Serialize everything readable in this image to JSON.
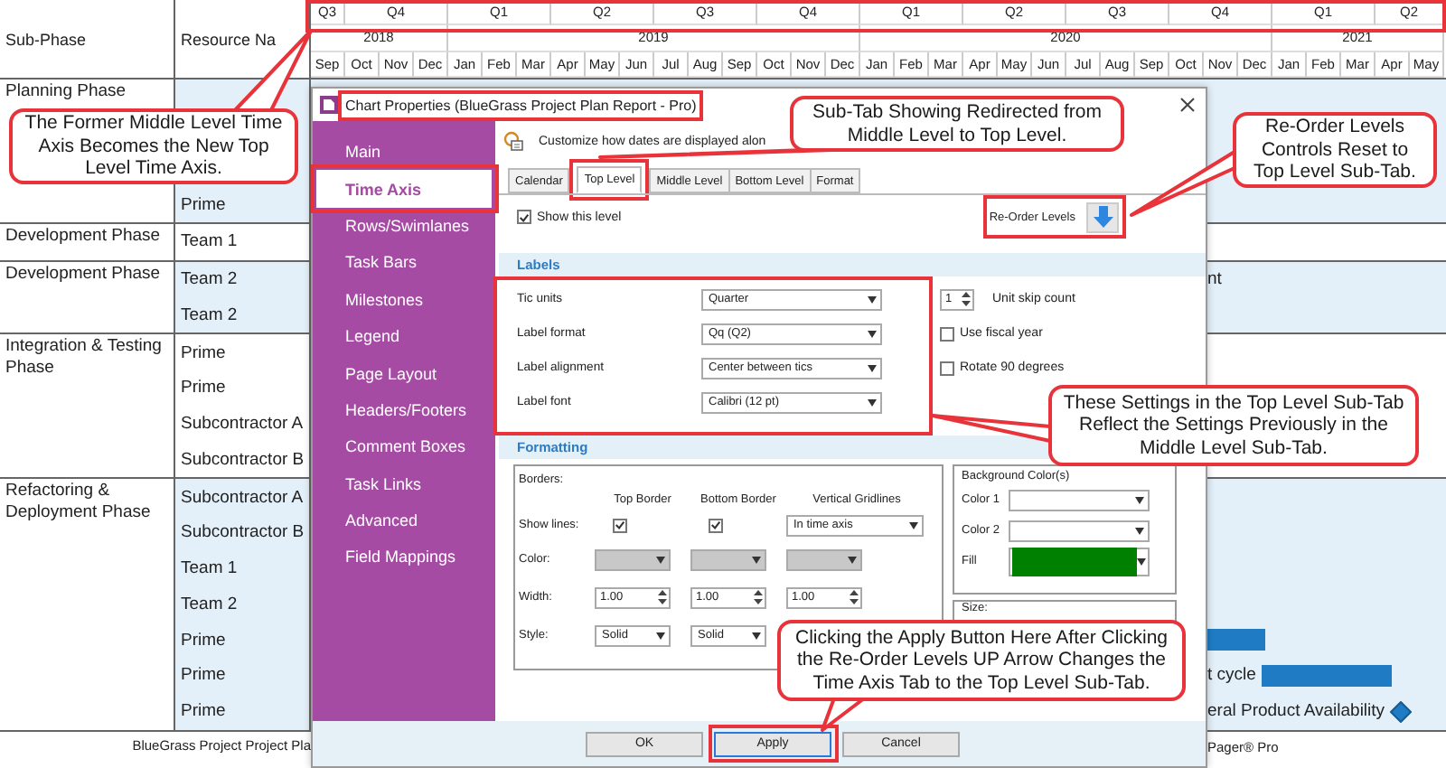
{
  "gantt": {
    "columns": [
      "Sub-Phase",
      "Resource Na"
    ],
    "years": [
      {
        "label": "2018",
        "quarters": [
          {
            "label": "Q3",
            "months": [
              "Sep"
            ]
          },
          {
            "label": "Q4",
            "months": [
              "Oct",
              "Nov",
              "Dec"
            ]
          }
        ]
      },
      {
        "label": "2019",
        "quarters": [
          {
            "label": "Q1",
            "months": [
              "Jan",
              "Feb",
              "Mar"
            ]
          },
          {
            "label": "Q2",
            "months": [
              "Apr",
              "May",
              "Jun"
            ]
          },
          {
            "label": "Q3",
            "months": [
              "Jul",
              "Aug",
              "Sep"
            ]
          },
          {
            "label": "Q4",
            "months": [
              "Oct",
              "Nov",
              "Dec"
            ]
          }
        ]
      },
      {
        "label": "2020",
        "quarters": [
          {
            "label": "Q1",
            "months": [
              "Jan",
              "Feb",
              "Mar"
            ]
          },
          {
            "label": "Q2",
            "months": [
              "Apr",
              "May",
              "Jun"
            ]
          },
          {
            "label": "Q3",
            "months": [
              "Jul",
              "Aug",
              "Sep"
            ]
          },
          {
            "label": "Q4",
            "months": [
              "Oct",
              "Nov",
              "Dec"
            ]
          }
        ]
      },
      {
        "label": "2021",
        "quarters": [
          {
            "label": "Q1",
            "months": [
              "Jan",
              "Feb",
              "Mar"
            ]
          },
          {
            "label": "Q2",
            "months": [
              "Apr",
              "May"
            ]
          }
        ]
      }
    ],
    "groups": [
      {
        "sub_phase": "Planning Phase",
        "rows": [
          {},
          {},
          {},
          {
            "resource": "Prime"
          }
        ]
      },
      {
        "sub_phase": "Development Phase",
        "rows": [
          {
            "resource": "Team 1"
          }
        ]
      },
      {
        "sub_phase": "Development Phase",
        "rows": [
          {
            "resource": "Team 2",
            "items": [
              {
                "kind": "label",
                "text": "nt"
              }
            ]
          },
          {
            "resource": "Team 2"
          }
        ]
      },
      {
        "sub_phase": "Integration & Testing Phase",
        "rows": [
          {
            "resource": "Prime"
          },
          {
            "resource": "Prime"
          },
          {
            "resource": "Subcontractor A"
          },
          {
            "resource": "Subcontractor B"
          }
        ]
      },
      {
        "sub_phase": "Refactoring & Deployment Phase",
        "rows": [
          {
            "resource": "Subcontractor A"
          },
          {
            "resource": "Subcontractor B"
          },
          {
            "resource": "Team 1"
          },
          {
            "resource": "Team 2"
          },
          {
            "resource": "Prime",
            "items": [
              {
                "kind": "bar"
              }
            ]
          },
          {
            "resource": "Prime",
            "items": [
              {
                "kind": "label",
                "text": "t cycle"
              },
              {
                "kind": "bar"
              }
            ]
          },
          {
            "resource": "Prime",
            "items": [
              {
                "kind": "label",
                "text": "eral Product Availability"
              },
              {
                "kind": "milestone"
              }
            ]
          }
        ]
      }
    ],
    "footer": [
      "BlueGrass Project Project Pla",
      "Pager® Pro"
    ]
  },
  "dialog": {
    "title": "Chart Properties (BlueGrass Project Plan Report - Pro)",
    "nav": [
      {
        "label": "Main",
        "selected": false
      },
      {
        "label": "Time Axis",
        "selected": true
      },
      {
        "label": "Rows/Swimlanes",
        "selected": false
      },
      {
        "label": "Task Bars",
        "selected": false
      },
      {
        "label": "Milestones",
        "selected": false
      },
      {
        "label": "Legend",
        "selected": false
      },
      {
        "label": "Page Layout",
        "selected": false
      },
      {
        "label": "Headers/Footers",
        "selected": false
      },
      {
        "label": "Comment Boxes",
        "selected": false
      },
      {
        "label": "Task Links",
        "selected": false
      },
      {
        "label": "Advanced",
        "selected": false
      },
      {
        "label": "Field Mappings",
        "selected": false
      }
    ],
    "description": "Customize how dates are displayed alon",
    "tabs": [
      {
        "label": "Calendar",
        "selected": false
      },
      {
        "label": "Top Level",
        "selected": true
      },
      {
        "label": "Middle Level",
        "selected": false
      },
      {
        "label": "Bottom Level",
        "selected": false
      },
      {
        "label": "Format",
        "selected": false
      }
    ],
    "show_level": {
      "label": "Show this level",
      "checked": true
    },
    "reorder_label": "Re-Order Levels",
    "labels": {
      "title": "Labels",
      "fields": [
        {
          "label": "Tic units",
          "value": "Quarter"
        },
        {
          "label": "Label format",
          "value": "Qq (Q2)"
        },
        {
          "label": "Label alignment",
          "value": "Center between tics"
        },
        {
          "label": "Label font",
          "value": "Calibri (12 pt)"
        }
      ],
      "skip": {
        "value": "1",
        "label": "Unit skip count"
      },
      "options": [
        {
          "label": "Use fiscal year",
          "checked": false
        },
        {
          "label": "Rotate 90 degrees",
          "checked": false
        }
      ]
    },
    "formatting": {
      "title": "Formatting",
      "borders": {
        "title": "Borders:",
        "columns": [
          "Top Border",
          "Bottom Border",
          "Vertical Gridlines"
        ],
        "show_lines": {
          "label": "Show lines:",
          "top": {
            "checked": true
          },
          "bottom": {
            "checked": true
          },
          "gridlines": "In time axis"
        },
        "color_label": "Color:",
        "width": {
          "label": "Width:",
          "values": [
            "1.00",
            "1.00",
            "1.00"
          ]
        },
        "style": {
          "label": "Style:",
          "values": [
            "Solid",
            "Solid"
          ]
        }
      },
      "background": {
        "title": "Background Color(s)",
        "color1": "Color 1",
        "color2": "Color 2",
        "fill": {
          "label": "Fill",
          "color": "#008000"
        }
      },
      "size_title": "Size:"
    },
    "buttons": [
      {
        "label": "OK",
        "focused": false
      },
      {
        "label": "Apply",
        "focused": true
      },
      {
        "label": "Cancel",
        "focused": false
      }
    ]
  },
  "callouts": [
    {
      "text": "The Former Middle Level Time Axis Becomes the New Top Level Time Axis."
    },
    {
      "text": "Sub-Tab Showing Redirected from Middle Level to Top Level."
    },
    {
      "text": "Re-Order Levels Controls Reset to Top Level Sub-Tab."
    },
    {
      "text": "These Settings in the Top Level Sub-Tab Reflect the Settings Previously in the Middle Level Sub-Tab."
    },
    {
      "text": "Clicking the Apply Button Here After Clicking the Re-Order Levels UP Arrow Changes the Time Axis Tab to the Top Level Sub-Tab."
    }
  ]
}
